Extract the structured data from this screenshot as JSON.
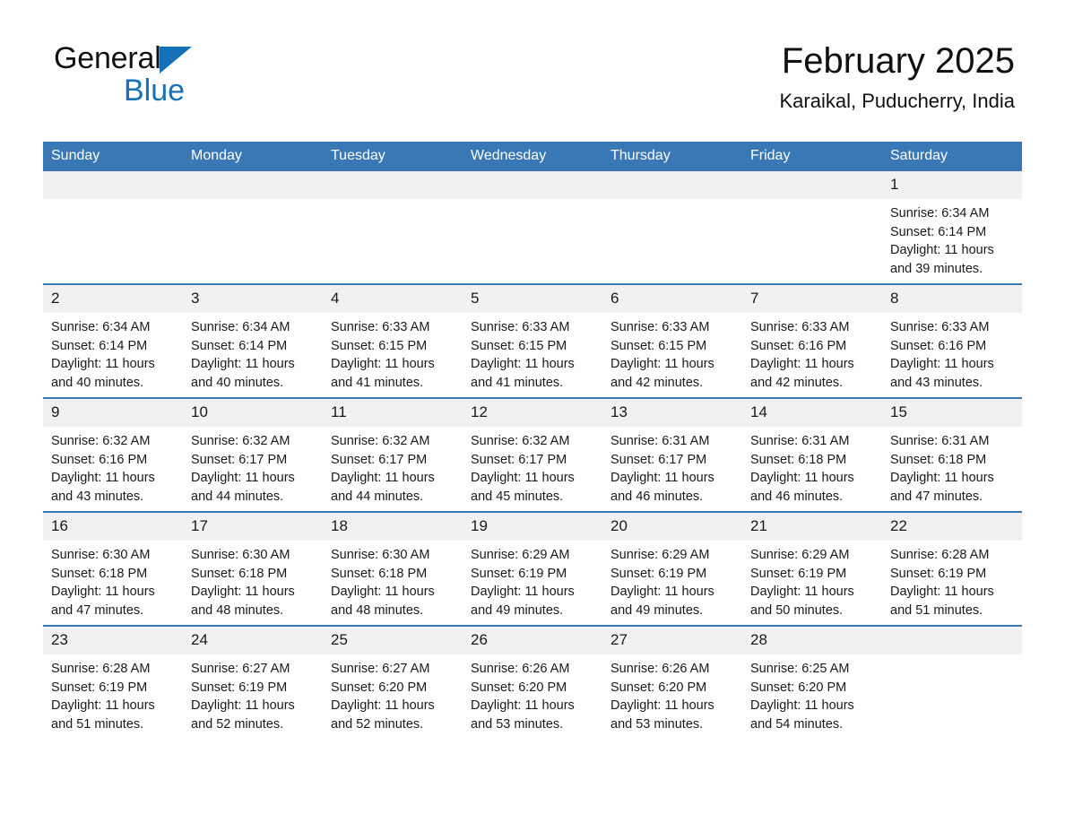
{
  "brand": {
    "name_part1": "General",
    "name_part2": "Blue",
    "accent_color": "#1571b8"
  },
  "header": {
    "title": "February 2025",
    "subtitle": "Karaikal, Puducherry, India"
  },
  "theme": {
    "header_blue": "#3a78b5",
    "daynum_band": "#f1f1f1",
    "text": "#1a1a1a"
  },
  "weekdays": [
    "Sunday",
    "Monday",
    "Tuesday",
    "Wednesday",
    "Thursday",
    "Friday",
    "Saturday"
  ],
  "labels": {
    "sunrise_prefix": "Sunrise:",
    "sunset_prefix": "Sunset:",
    "daylight_prefix": "Daylight:"
  },
  "weeks": [
    [
      {
        "day": "",
        "blank": true
      },
      {
        "day": "",
        "blank": true
      },
      {
        "day": "",
        "blank": true
      },
      {
        "day": "",
        "blank": true
      },
      {
        "day": "",
        "blank": true
      },
      {
        "day": "",
        "blank": true
      },
      {
        "day": "1",
        "sunrise": "Sunrise: 6:34 AM",
        "sunset": "Sunset: 6:14 PM",
        "daylight": "Daylight: 11 hours and 39 minutes."
      }
    ],
    [
      {
        "day": "2",
        "sunrise": "Sunrise: 6:34 AM",
        "sunset": "Sunset: 6:14 PM",
        "daylight": "Daylight: 11 hours and 40 minutes."
      },
      {
        "day": "3",
        "sunrise": "Sunrise: 6:34 AM",
        "sunset": "Sunset: 6:14 PM",
        "daylight": "Daylight: 11 hours and 40 minutes."
      },
      {
        "day": "4",
        "sunrise": "Sunrise: 6:33 AM",
        "sunset": "Sunset: 6:15 PM",
        "daylight": "Daylight: 11 hours and 41 minutes."
      },
      {
        "day": "5",
        "sunrise": "Sunrise: 6:33 AM",
        "sunset": "Sunset: 6:15 PM",
        "daylight": "Daylight: 11 hours and 41 minutes."
      },
      {
        "day": "6",
        "sunrise": "Sunrise: 6:33 AM",
        "sunset": "Sunset: 6:15 PM",
        "daylight": "Daylight: 11 hours and 42 minutes."
      },
      {
        "day": "7",
        "sunrise": "Sunrise: 6:33 AM",
        "sunset": "Sunset: 6:16 PM",
        "daylight": "Daylight: 11 hours and 42 minutes."
      },
      {
        "day": "8",
        "sunrise": "Sunrise: 6:33 AM",
        "sunset": "Sunset: 6:16 PM",
        "daylight": "Daylight: 11 hours and 43 minutes."
      }
    ],
    [
      {
        "day": "9",
        "sunrise": "Sunrise: 6:32 AM",
        "sunset": "Sunset: 6:16 PM",
        "daylight": "Daylight: 11 hours and 43 minutes."
      },
      {
        "day": "10",
        "sunrise": "Sunrise: 6:32 AM",
        "sunset": "Sunset: 6:17 PM",
        "daylight": "Daylight: 11 hours and 44 minutes."
      },
      {
        "day": "11",
        "sunrise": "Sunrise: 6:32 AM",
        "sunset": "Sunset: 6:17 PM",
        "daylight": "Daylight: 11 hours and 44 minutes."
      },
      {
        "day": "12",
        "sunrise": "Sunrise: 6:32 AM",
        "sunset": "Sunset: 6:17 PM",
        "daylight": "Daylight: 11 hours and 45 minutes."
      },
      {
        "day": "13",
        "sunrise": "Sunrise: 6:31 AM",
        "sunset": "Sunset: 6:17 PM",
        "daylight": "Daylight: 11 hours and 46 minutes."
      },
      {
        "day": "14",
        "sunrise": "Sunrise: 6:31 AM",
        "sunset": "Sunset: 6:18 PM",
        "daylight": "Daylight: 11 hours and 46 minutes."
      },
      {
        "day": "15",
        "sunrise": "Sunrise: 6:31 AM",
        "sunset": "Sunset: 6:18 PM",
        "daylight": "Daylight: 11 hours and 47 minutes."
      }
    ],
    [
      {
        "day": "16",
        "sunrise": "Sunrise: 6:30 AM",
        "sunset": "Sunset: 6:18 PM",
        "daylight": "Daylight: 11 hours and 47 minutes."
      },
      {
        "day": "17",
        "sunrise": "Sunrise: 6:30 AM",
        "sunset": "Sunset: 6:18 PM",
        "daylight": "Daylight: 11 hours and 48 minutes."
      },
      {
        "day": "18",
        "sunrise": "Sunrise: 6:30 AM",
        "sunset": "Sunset: 6:18 PM",
        "daylight": "Daylight: 11 hours and 48 minutes."
      },
      {
        "day": "19",
        "sunrise": "Sunrise: 6:29 AM",
        "sunset": "Sunset: 6:19 PM",
        "daylight": "Daylight: 11 hours and 49 minutes."
      },
      {
        "day": "20",
        "sunrise": "Sunrise: 6:29 AM",
        "sunset": "Sunset: 6:19 PM",
        "daylight": "Daylight: 11 hours and 49 minutes."
      },
      {
        "day": "21",
        "sunrise": "Sunrise: 6:29 AM",
        "sunset": "Sunset: 6:19 PM",
        "daylight": "Daylight: 11 hours and 50 minutes."
      },
      {
        "day": "22",
        "sunrise": "Sunrise: 6:28 AM",
        "sunset": "Sunset: 6:19 PM",
        "daylight": "Daylight: 11 hours and 51 minutes."
      }
    ],
    [
      {
        "day": "23",
        "sunrise": "Sunrise: 6:28 AM",
        "sunset": "Sunset: 6:19 PM",
        "daylight": "Daylight: 11 hours and 51 minutes."
      },
      {
        "day": "24",
        "sunrise": "Sunrise: 6:27 AM",
        "sunset": "Sunset: 6:19 PM",
        "daylight": "Daylight: 11 hours and 52 minutes."
      },
      {
        "day": "25",
        "sunrise": "Sunrise: 6:27 AM",
        "sunset": "Sunset: 6:20 PM",
        "daylight": "Daylight: 11 hours and 52 minutes."
      },
      {
        "day": "26",
        "sunrise": "Sunrise: 6:26 AM",
        "sunset": "Sunset: 6:20 PM",
        "daylight": "Daylight: 11 hours and 53 minutes."
      },
      {
        "day": "27",
        "sunrise": "Sunrise: 6:26 AM",
        "sunset": "Sunset: 6:20 PM",
        "daylight": "Daylight: 11 hours and 53 minutes."
      },
      {
        "day": "28",
        "sunrise": "Sunrise: 6:25 AM",
        "sunset": "Sunset: 6:20 PM",
        "daylight": "Daylight: 11 hours and 54 minutes."
      },
      {
        "day": "",
        "blank": true
      }
    ]
  ]
}
